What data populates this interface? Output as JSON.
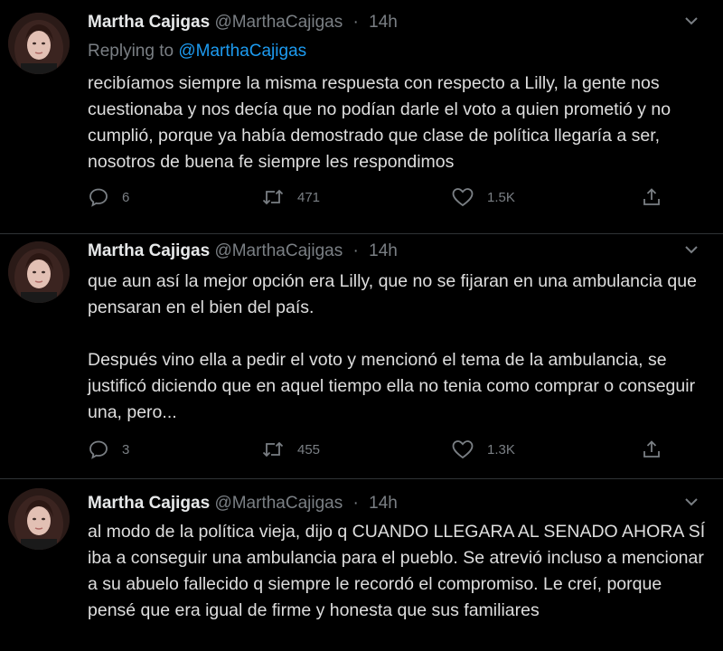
{
  "tweets": [
    {
      "name": "Martha Cajigas",
      "handle": "@MarthaCajigas",
      "dot": "·",
      "time": "14h",
      "replying_prefix": "Replying to ",
      "replying_to": "@MarthaCajigas",
      "paragraphs": [
        "recibíamos siempre la misma respuesta con respecto a Lilly, la gente nos cuestionaba y nos decía que no podían darle el voto a quien prometió y no cumplió, porque ya había demostrado que clase de política llegaría a ser, nosotros de buena fe siempre les respondimos"
      ],
      "replies": "6",
      "retweets": "471",
      "likes": "1.5K"
    },
    {
      "name": "Martha Cajigas",
      "handle": "@MarthaCajigas",
      "dot": "·",
      "time": "14h",
      "paragraphs": [
        "que aun así la mejor opción era Lilly,  que no se fijaran en una ambulancia que pensaran en el bien del país.",
        "Después vino ella a pedir el voto y mencionó el tema de la ambulancia, se justificó diciendo que en aquel tiempo ella no tenia como comprar o conseguir una, pero..."
      ],
      "replies": "3",
      "retweets": "455",
      "likes": "1.3K"
    },
    {
      "name": "Martha Cajigas",
      "handle": "@MarthaCajigas",
      "dot": "·",
      "time": "14h",
      "paragraphs": [
        "al modo de la política vieja, dijo q CUANDO LLEGARA AL SENADO AHORA SÍ iba a conseguir una ambulancia para el pueblo. Se atrevió incluso a mencionar a su abuelo fallecido q siempre le recordó el compromiso. Le creí, porque pensé que era igual de firme y honesta que sus familiares"
      ]
    }
  ],
  "icons": {
    "reply": "comment-bubble-icon",
    "retweet": "retweet-arrows-icon",
    "like": "heart-icon",
    "share": "share-upload-icon",
    "caret": "chevron-down-icon",
    "avatar": "profile-photo"
  },
  "colors": {
    "background": "#000000",
    "text": "#dedede",
    "muted": "#7a7f84",
    "mention": "#1d9bf0",
    "separator": "#2f3336"
  }
}
